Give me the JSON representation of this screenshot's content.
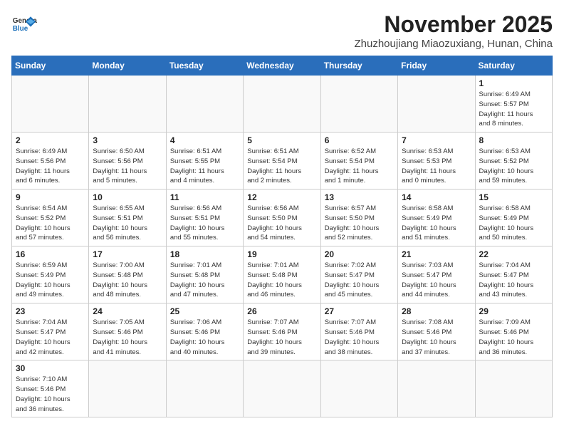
{
  "header": {
    "logo_line1": "General",
    "logo_line2": "Blue",
    "month": "November 2025",
    "location": "Zhuzhoujiang Miaozuxiang, Hunan, China"
  },
  "weekdays": [
    "Sunday",
    "Monday",
    "Tuesday",
    "Wednesday",
    "Thursday",
    "Friday",
    "Saturday"
  ],
  "weeks": [
    [
      {
        "day": "",
        "info": ""
      },
      {
        "day": "",
        "info": ""
      },
      {
        "day": "",
        "info": ""
      },
      {
        "day": "",
        "info": ""
      },
      {
        "day": "",
        "info": ""
      },
      {
        "day": "",
        "info": ""
      },
      {
        "day": "1",
        "info": "Sunrise: 6:49 AM\nSunset: 5:57 PM\nDaylight: 11 hours\nand 8 minutes."
      }
    ],
    [
      {
        "day": "2",
        "info": "Sunrise: 6:49 AM\nSunset: 5:56 PM\nDaylight: 11 hours\nand 6 minutes."
      },
      {
        "day": "3",
        "info": "Sunrise: 6:50 AM\nSunset: 5:56 PM\nDaylight: 11 hours\nand 5 minutes."
      },
      {
        "day": "4",
        "info": "Sunrise: 6:51 AM\nSunset: 5:55 PM\nDaylight: 11 hours\nand 4 minutes."
      },
      {
        "day": "5",
        "info": "Sunrise: 6:51 AM\nSunset: 5:54 PM\nDaylight: 11 hours\nand 2 minutes."
      },
      {
        "day": "6",
        "info": "Sunrise: 6:52 AM\nSunset: 5:54 PM\nDaylight: 11 hours\nand 1 minute."
      },
      {
        "day": "7",
        "info": "Sunrise: 6:53 AM\nSunset: 5:53 PM\nDaylight: 11 hours\nand 0 minutes."
      },
      {
        "day": "8",
        "info": "Sunrise: 6:53 AM\nSunset: 5:52 PM\nDaylight: 10 hours\nand 59 minutes."
      }
    ],
    [
      {
        "day": "9",
        "info": "Sunrise: 6:54 AM\nSunset: 5:52 PM\nDaylight: 10 hours\nand 57 minutes."
      },
      {
        "day": "10",
        "info": "Sunrise: 6:55 AM\nSunset: 5:51 PM\nDaylight: 10 hours\nand 56 minutes."
      },
      {
        "day": "11",
        "info": "Sunrise: 6:56 AM\nSunset: 5:51 PM\nDaylight: 10 hours\nand 55 minutes."
      },
      {
        "day": "12",
        "info": "Sunrise: 6:56 AM\nSunset: 5:50 PM\nDaylight: 10 hours\nand 54 minutes."
      },
      {
        "day": "13",
        "info": "Sunrise: 6:57 AM\nSunset: 5:50 PM\nDaylight: 10 hours\nand 52 minutes."
      },
      {
        "day": "14",
        "info": "Sunrise: 6:58 AM\nSunset: 5:49 PM\nDaylight: 10 hours\nand 51 minutes."
      },
      {
        "day": "15",
        "info": "Sunrise: 6:58 AM\nSunset: 5:49 PM\nDaylight: 10 hours\nand 50 minutes."
      }
    ],
    [
      {
        "day": "16",
        "info": "Sunrise: 6:59 AM\nSunset: 5:49 PM\nDaylight: 10 hours\nand 49 minutes."
      },
      {
        "day": "17",
        "info": "Sunrise: 7:00 AM\nSunset: 5:48 PM\nDaylight: 10 hours\nand 48 minutes."
      },
      {
        "day": "18",
        "info": "Sunrise: 7:01 AM\nSunset: 5:48 PM\nDaylight: 10 hours\nand 47 minutes."
      },
      {
        "day": "19",
        "info": "Sunrise: 7:01 AM\nSunset: 5:48 PM\nDaylight: 10 hours\nand 46 minutes."
      },
      {
        "day": "20",
        "info": "Sunrise: 7:02 AM\nSunset: 5:47 PM\nDaylight: 10 hours\nand 45 minutes."
      },
      {
        "day": "21",
        "info": "Sunrise: 7:03 AM\nSunset: 5:47 PM\nDaylight: 10 hours\nand 44 minutes."
      },
      {
        "day": "22",
        "info": "Sunrise: 7:04 AM\nSunset: 5:47 PM\nDaylight: 10 hours\nand 43 minutes."
      }
    ],
    [
      {
        "day": "23",
        "info": "Sunrise: 7:04 AM\nSunset: 5:47 PM\nDaylight: 10 hours\nand 42 minutes."
      },
      {
        "day": "24",
        "info": "Sunrise: 7:05 AM\nSunset: 5:46 PM\nDaylight: 10 hours\nand 41 minutes."
      },
      {
        "day": "25",
        "info": "Sunrise: 7:06 AM\nSunset: 5:46 PM\nDaylight: 10 hours\nand 40 minutes."
      },
      {
        "day": "26",
        "info": "Sunrise: 7:07 AM\nSunset: 5:46 PM\nDaylight: 10 hours\nand 39 minutes."
      },
      {
        "day": "27",
        "info": "Sunrise: 7:07 AM\nSunset: 5:46 PM\nDaylight: 10 hours\nand 38 minutes."
      },
      {
        "day": "28",
        "info": "Sunrise: 7:08 AM\nSunset: 5:46 PM\nDaylight: 10 hours\nand 37 minutes."
      },
      {
        "day": "29",
        "info": "Sunrise: 7:09 AM\nSunset: 5:46 PM\nDaylight: 10 hours\nand 36 minutes."
      }
    ],
    [
      {
        "day": "30",
        "info": "Sunrise: 7:10 AM\nSunset: 5:46 PM\nDaylight: 10 hours\nand 36 minutes."
      },
      {
        "day": "",
        "info": ""
      },
      {
        "day": "",
        "info": ""
      },
      {
        "day": "",
        "info": ""
      },
      {
        "day": "",
        "info": ""
      },
      {
        "day": "",
        "info": ""
      },
      {
        "day": "",
        "info": ""
      }
    ]
  ]
}
